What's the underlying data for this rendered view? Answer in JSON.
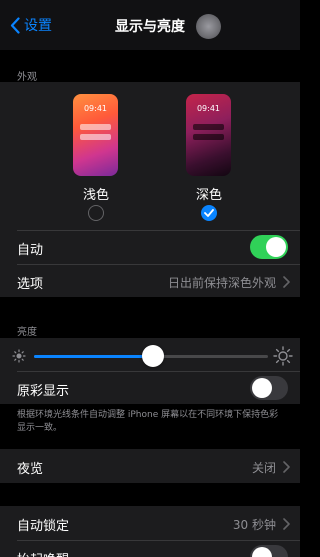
{
  "nav": {
    "back_label": "设置",
    "title": "显示与亮度"
  },
  "appearance": {
    "header": "外观",
    "light": {
      "label": "浅色",
      "time": "09:41",
      "selected": false
    },
    "dark": {
      "label": "深色",
      "time": "09:41",
      "selected": true
    },
    "automatic": {
      "label": "自动",
      "on": true
    },
    "options": {
      "label": "选项",
      "value": "日出前保持深色外观"
    }
  },
  "brightness": {
    "header": "亮度",
    "level_fraction": 0.51,
    "true_tone": {
      "label": "原彩显示",
      "on": false
    },
    "footnote": "根据环境光线条件自动调整 iPhone 屏幕以在不同环境下保持色彩显示一致。"
  },
  "night_shift": {
    "label": "夜览",
    "value": "关闭"
  },
  "auto_lock": {
    "label": "自动锁定",
    "value": "30 秒钟"
  },
  "raise_to_wake": {
    "label": "抬起唤醒",
    "on": false
  },
  "colors": {
    "accent": "#0a84ff",
    "toggle_on": "#30d158",
    "group_bg": "#1c1c1e",
    "secondary_text": "#8e8e93"
  }
}
